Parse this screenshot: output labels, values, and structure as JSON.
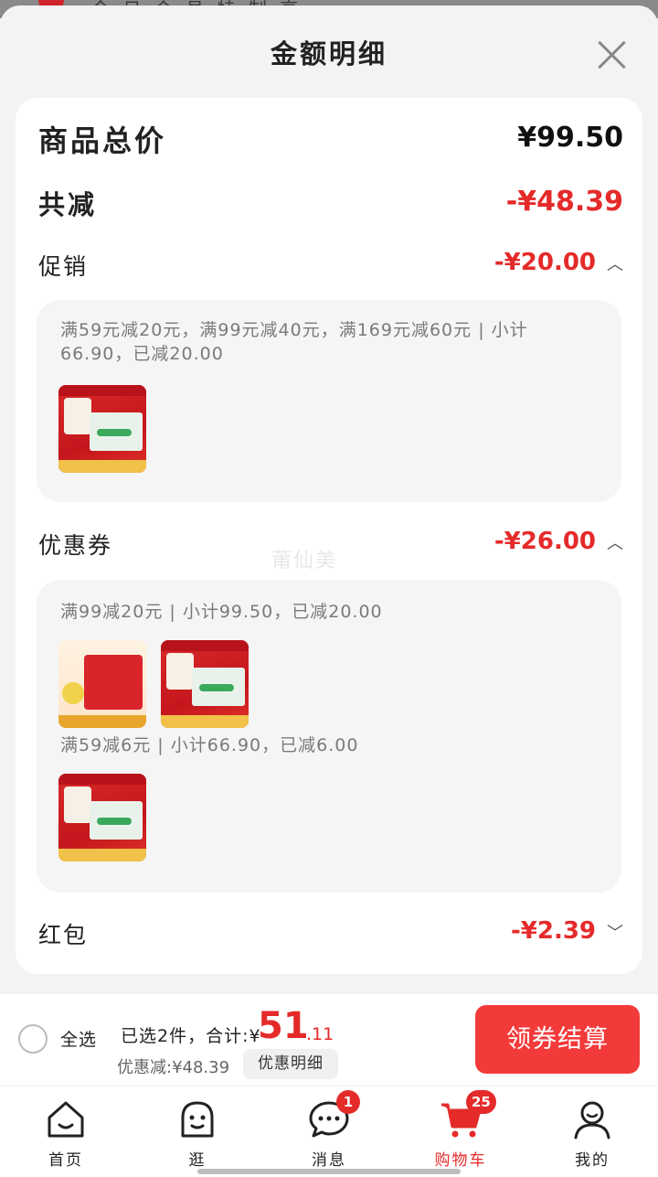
{
  "background": {
    "partial_text": "今 日 会 员 特 制 亮"
  },
  "sheet": {
    "title": "金额明细",
    "close_icon": "close-icon"
  },
  "summary": {
    "total_label": "商品总价",
    "total_value": "¥99.50",
    "reduce_label": "共减",
    "reduce_value": "-¥48.39"
  },
  "promo": {
    "label": "促销",
    "value": "-¥20.00",
    "description": "满59元减20元，满99元减40元，满169元减60元 | 小计66.90，已减20.00"
  },
  "coupon": {
    "label": "优惠券",
    "value": "-¥26.00",
    "groups": [
      {
        "description": "满99减20元 | 小计99.50，已减20.00"
      },
      {
        "description": "满59减6元 | 小计66.90，已减6.00"
      }
    ]
  },
  "red_packet": {
    "label": "红包",
    "value": "-¥2.39"
  },
  "watermark": "莆仙美",
  "bottom": {
    "select_all_label": "全选",
    "selected_label": "已选2件，合计:¥",
    "total_int": "51",
    "total_dec": ".11",
    "discount_label": "优惠减:¥48.39",
    "detail_button": "优惠明细",
    "checkout_button": "领券结算"
  },
  "tabs": [
    {
      "label": "首页",
      "icon": "home-icon"
    },
    {
      "label": "逛",
      "icon": "browse-icon"
    },
    {
      "label": "消息",
      "icon": "message-icon",
      "badge": "1"
    },
    {
      "label": "购物车",
      "icon": "cart-icon",
      "badge": "25",
      "active": true
    },
    {
      "label": "我的",
      "icon": "profile-icon"
    }
  ],
  "colors": {
    "accent": "#e52a2a",
    "checkout": "#f33a3a"
  }
}
